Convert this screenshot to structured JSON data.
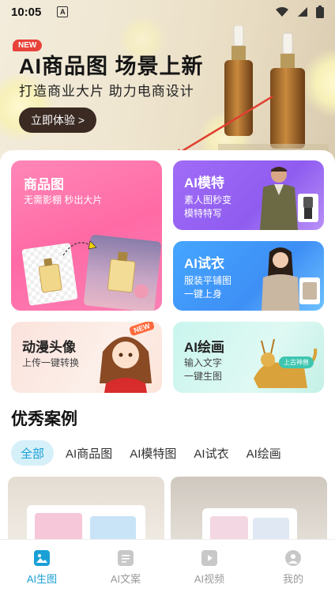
{
  "status_bar": {
    "time": "10:05",
    "notification_icon": "A"
  },
  "hero": {
    "badge": "NEW",
    "title": "AI商品图 场景上新",
    "subtitle": "打造商业大片 助力电商设计",
    "cta_label": "立即体验 >"
  },
  "features": {
    "product": {
      "title": "商品图",
      "subtitle": "无需影棚 秒出大片"
    },
    "model": {
      "title": "AI模特",
      "line1": "素人图秒变",
      "line2": "模特特写"
    },
    "tryon": {
      "title": "AI试衣",
      "line1": "服装平铺图",
      "line2": "一键上身"
    },
    "avatar": {
      "title": "动漫头像",
      "subtitle": "上传一键转换",
      "badge": "NEW"
    },
    "draw": {
      "title": "AI绘画",
      "line1": "输入文字",
      "line2": "一键生图",
      "tag": "上古神兽"
    }
  },
  "cases": {
    "title": "优秀案例",
    "filters": [
      "全部",
      "AI商品图",
      "AI模特图",
      "AI试衣",
      "AI绘画"
    ],
    "active_filter": 0
  },
  "tabbar": {
    "tabs": [
      {
        "label": "AI生图",
        "icon": "image-icon"
      },
      {
        "label": "AI文案",
        "icon": "document-icon"
      },
      {
        "label": "AI视频",
        "icon": "video-icon"
      },
      {
        "label": "我的",
        "icon": "user-icon"
      }
    ],
    "active": 0
  },
  "colors": {
    "accent": "#1a9fd6",
    "product_card": "#ff6aa5",
    "model_card": "#8f5cf0",
    "tryon_card": "#3e8ff5",
    "hero_cta": "#3a2a22"
  }
}
